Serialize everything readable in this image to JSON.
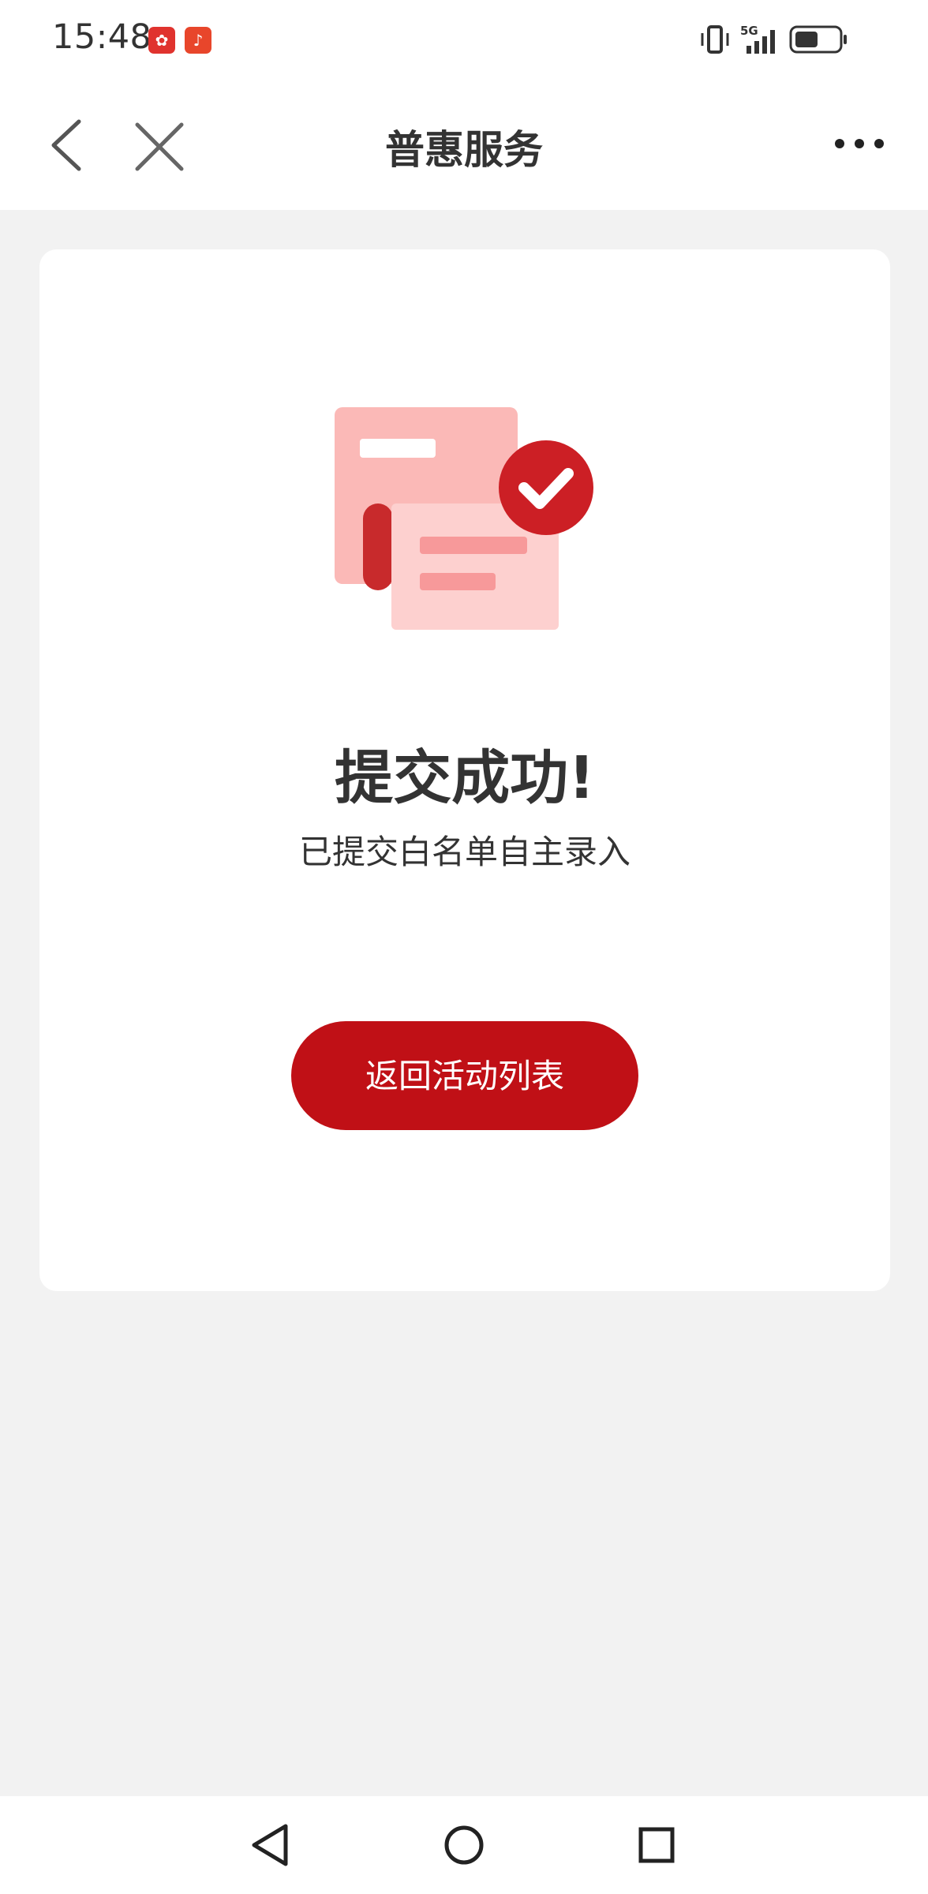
{
  "status_bar": {
    "time": "15:48",
    "network": "5G",
    "icons": [
      "huawei-app-icon",
      "listen-app-icon",
      "vibrate-icon",
      "signal-icon",
      "battery-icon"
    ]
  },
  "navbar": {
    "title": "普惠服务",
    "icons": [
      "back-icon",
      "close-icon",
      "more-icon"
    ]
  },
  "result": {
    "title": "提交成功!",
    "description": "已提交白名单自主录入",
    "button_label": "返回活动列表"
  },
  "colors": {
    "accent": "#c01016",
    "page_background": "#f2f2f2"
  },
  "system_nav": {
    "icons": [
      "nav-back-icon",
      "nav-home-icon",
      "nav-recents-icon"
    ]
  }
}
